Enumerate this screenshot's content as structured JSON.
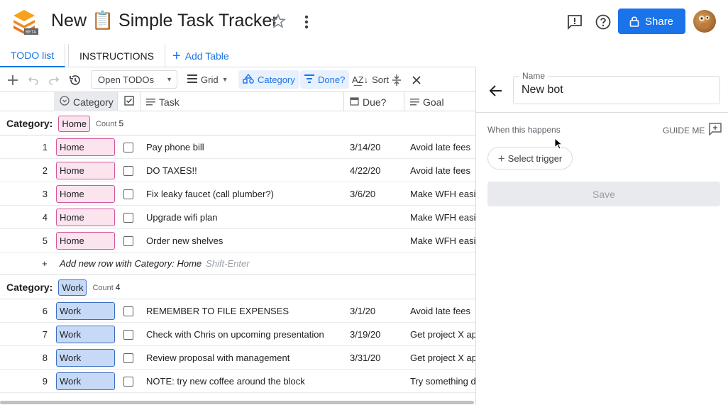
{
  "header": {
    "title": "New 📋 Simple Task Tracker",
    "share_label": "Share",
    "logo_badge": "BETA"
  },
  "tabs": [
    {
      "label": "TODO list"
    },
    {
      "label": "INSTRUCTIONS"
    },
    {
      "label": "Add Table"
    }
  ],
  "toolbar": {
    "view_label": "Open TODOs",
    "grid_label": "Grid",
    "category_label": "Category",
    "done_label": "Done?",
    "sort_label": "Sort"
  },
  "columns": {
    "category": "Category",
    "task": "Task",
    "due": "Due?",
    "goal": "Goal"
  },
  "groups": [
    {
      "label": "Category:",
      "value": "Home",
      "count_label": "Count",
      "count": "5"
    },
    {
      "label": "Category:",
      "value": "Work",
      "count_label": "Count",
      "count": "4"
    }
  ],
  "rows": [
    {
      "num": "1",
      "category": "Home",
      "task": "Pay phone bill",
      "due": "3/14/20",
      "goal": "Avoid late fees"
    },
    {
      "num": "2",
      "category": "Home",
      "task": "DO TAXES!!",
      "due": "4/22/20",
      "goal": "Avoid late fees"
    },
    {
      "num": "3",
      "category": "Home",
      "task": "Fix leaky faucet (call plumber?)",
      "due": "3/6/20",
      "goal": "Make WFH easier"
    },
    {
      "num": "4",
      "category": "Home",
      "task": "Upgrade wifi plan",
      "due": "",
      "goal": "Make WFH easier"
    },
    {
      "num": "5",
      "category": "Home",
      "task": "Order new shelves",
      "due": "",
      "goal": "Make WFH easier"
    },
    {
      "num": "6",
      "category": "Work",
      "task": "REMEMBER TO FILE EXPENSES",
      "due": "3/1/20",
      "goal": "Avoid late fees"
    },
    {
      "num": "7",
      "category": "Work",
      "task": "Check with Chris on upcoming presentation",
      "due": "3/19/20",
      "goal": "Get project X approved"
    },
    {
      "num": "8",
      "category": "Work",
      "task": "Review proposal with management",
      "due": "3/31/20",
      "goal": "Get project X approved"
    },
    {
      "num": "9",
      "category": "Work",
      "task": "NOTE: try new coffee around the block",
      "due": "",
      "goal": "Try something different"
    }
  ],
  "add_row": {
    "plus": "+",
    "text": "Add new row with Category: Home",
    "hint": "Shift-Enter"
  },
  "panel": {
    "name_label": "Name",
    "name_value": "New bot",
    "when_label": "When this happens",
    "guide_label": "GUIDE ME",
    "trigger_label": "Select trigger",
    "save_label": "Save"
  },
  "colors": {
    "accent": "#1a73e8",
    "home_chip": "#fce4ef",
    "work_chip": "#c6daf7"
  }
}
